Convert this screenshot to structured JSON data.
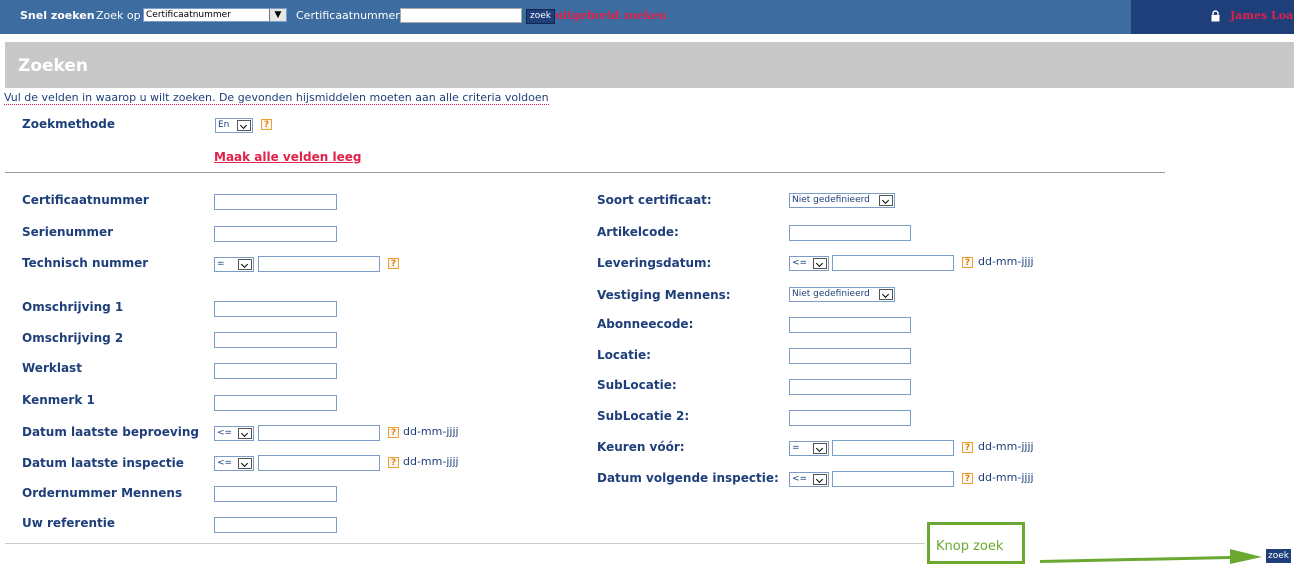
{
  "topbar": {
    "quick_search_label": "Snel zoeken",
    "search_by_label": "Zoek op",
    "search_by_value": "Certificaatnummer",
    "field_label": "Certificaatnummer",
    "search_button": "zoek",
    "advanced_link": "uitgebreid zoeken",
    "user_name": "James Loa"
  },
  "title": "Zoeken",
  "intro": "Vul de velden in waarop u wilt zoeken. De gevonden hijsmiddelen moeten aan alle criteria voldoen",
  "method": {
    "label": "Zoekmethode",
    "value": "En",
    "help": "?"
  },
  "clear_link": "Maak alle velden leeg",
  "left": {
    "certificaatnummer": "Certificaatnummer",
    "serienummer": "Serienummer",
    "technisch_nummer": "Technisch nummer",
    "technisch_op": "=",
    "omschrijving1": "Omschrijving 1",
    "omschrijving2": "Omschrijving 2",
    "werklast": "Werklast",
    "kenmerk1": "Kenmerk 1",
    "datum_beproeving": "Datum laatste beproeving",
    "datum_beproeving_op": "<=",
    "datum_inspectie": "Datum laatste inspectie",
    "datum_inspectie_op": "<=",
    "ordernummer": "Ordernummer Mennens",
    "uw_referentie": "Uw referentie"
  },
  "right": {
    "soort_certificaat": "Soort certificaat:",
    "soort_certificaat_value": "Niet gedefinieerd",
    "artikelcode": "Artikelcode:",
    "leveringsdatum": "Leveringsdatum:",
    "leveringsdatum_op": "<=",
    "vestiging": "Vestiging Mennens:",
    "vestiging_value": "Niet gedefinieerd",
    "abonneecode": "Abonneecode:",
    "locatie": "Locatie:",
    "sublocatie": "SubLocatie:",
    "sublocatie2": "SubLocatie 2:",
    "keuren_voor": "Keuren vóór:",
    "keuren_voor_op": "=",
    "datum_volgende": "Datum volgende inspectie:",
    "datum_volgende_op": "<="
  },
  "date_format": "dd-mm-jjjj",
  "help_mark": "?",
  "callout_label": "Knop zoek",
  "submit_button": "zoek",
  "colors": {
    "topbar": "#3d6ca0",
    "navy": "#1e3f7a",
    "link": "#e0214a",
    "callout": "#6aa832"
  }
}
